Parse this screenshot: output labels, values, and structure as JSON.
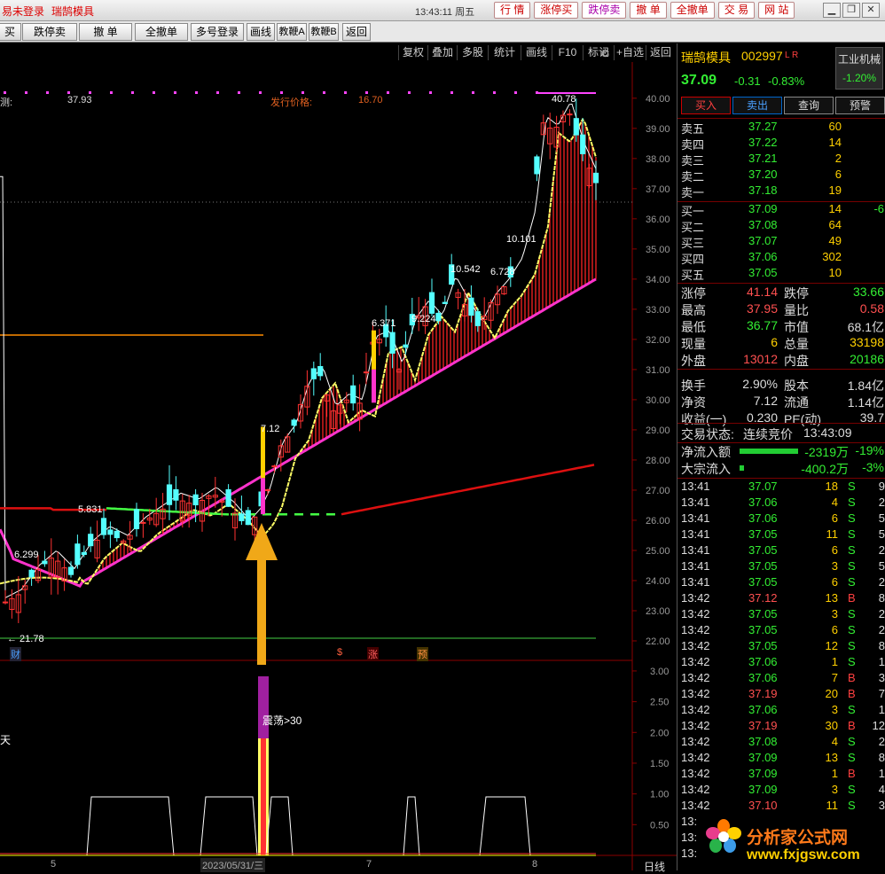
{
  "titlebar": {
    "status": "易未登录",
    "stock": "瑞鹄模具",
    "time": "13:43:11",
    "weekday": "周五",
    "buttons": [
      "行 情",
      "涨停买",
      "跌停卖",
      "撤 单",
      "全撤单",
      "交 易",
      "网 站"
    ],
    "window_icons": [
      "minimize-icon",
      "restore-icon",
      "close-icon"
    ]
  },
  "tradebar": {
    "buttons": [
      "买",
      "跌停卖",
      "撤 单",
      "全撤单",
      "多号登录",
      "画线",
      "教鞭A",
      "教鞭B",
      "返回"
    ]
  },
  "charttool": {
    "buttons": [
      "复权",
      "叠加",
      "多股",
      "统计",
      "画线",
      "F10",
      "标记",
      "+自选",
      "返回"
    ],
    "corner_icon": "gear-icon"
  },
  "chart_labels": {
    "predict_label": "测:",
    "predict_value": "37.93",
    "issue_label": "发行价格:",
    "issue_value": "16.70",
    "annotations": [
      "40.78",
      "10.101",
      "10.542",
      "6.728",
      "9.224",
      "6.371",
      "7.12",
      "5.831",
      "6.299",
      "← 21.78"
    ],
    "markers": [
      "财",
      "$",
      "涨",
      "预"
    ],
    "osc_label": "震荡>30",
    "left_label": "天",
    "date_label": "2023/05/31/三",
    "x_ticks": [
      "5",
      "7",
      "8"
    ],
    "day_line": "日线"
  },
  "chart_data": [
    {
      "type": "line",
      "title": "",
      "y_ticks": [
        "40.00",
        "39.00",
        "38.00",
        "37.00",
        "36.00",
        "35.00",
        "34.00",
        "33.00",
        "32.00",
        "31.00",
        "30.00",
        "29.00",
        "28.00",
        "27.00",
        "26.00",
        "25.00",
        "24.00",
        "23.00",
        "22.00"
      ],
      "ylim": [
        21.5,
        41.2
      ]
    },
    {
      "type": "line",
      "title": "",
      "y_ticks": [
        "3.00",
        "2.50",
        "2.00",
        "1.50",
        "1.00",
        "0.50"
      ],
      "ylim": [
        0,
        3.1
      ]
    }
  ],
  "colors": {
    "up": "#ff3232",
    "down": "#54ffff",
    "ma_white": "#ffffff",
    "ma_yellow": "#ffff66",
    "ma_magenta": "#ff33cc",
    "ma_red": "#dd1010",
    "ma_green": "#44ff44",
    "text_red": "#ff5050",
    "text_green": "#33ee33",
    "text_yellow": "#ffff00"
  },
  "quote": {
    "name": "瑞鹄模具",
    "code": "002997",
    "flags": "L R",
    "industry": "工业机械",
    "price": "37.09",
    "change": "-0.31",
    "pct": "-0.83%",
    "industry_pct": "-1.20%",
    "buttons": [
      "买入",
      "卖出",
      "查询",
      "预警"
    ],
    "asks": [
      {
        "label": "卖五",
        "price": "37.27",
        "vol": "60"
      },
      {
        "label": "卖四",
        "price": "37.22",
        "vol": "14"
      },
      {
        "label": "卖三",
        "price": "37.21",
        "vol": "2"
      },
      {
        "label": "卖二",
        "price": "37.20",
        "vol": "6"
      },
      {
        "label": "卖一",
        "price": "37.18",
        "vol": "19"
      }
    ],
    "bids": [
      {
        "label": "买一",
        "price": "37.09",
        "vol": "14",
        "extra": "-6"
      },
      {
        "label": "买二",
        "price": "37.08",
        "vol": "64",
        "extra": ""
      },
      {
        "label": "买三",
        "price": "37.07",
        "vol": "49",
        "extra": ""
      },
      {
        "label": "买四",
        "price": "37.06",
        "vol": "302",
        "extra": ""
      },
      {
        "label": "买五",
        "price": "37.05",
        "vol": "10",
        "extra": ""
      }
    ],
    "stats": [
      {
        "l1": "涨停",
        "v1": "41.14",
        "l2": "跌停",
        "v2": "33.66"
      },
      {
        "l1": "最高",
        "v1": "37.95",
        "l2": "量比",
        "v2": "0.58"
      },
      {
        "l1": "最低",
        "v1": "36.77",
        "l2": "市值",
        "v2": "68.1亿"
      },
      {
        "l1": "现量",
        "v1": "6",
        "l2": "总量",
        "v2": "33198"
      },
      {
        "l1": "外盘",
        "v1": "13012",
        "l2": "内盘",
        "v2": "20186"
      },
      {
        "l1": "换手",
        "v1": "2.90%",
        "l2": "股本",
        "v2": "1.84亿"
      },
      {
        "l1": "净资",
        "v1": "7.12",
        "l2": "流通",
        "v2": "1.14亿"
      },
      {
        "l1": "收益(一)",
        "v1": "0.230",
        "l2": "PE(动)",
        "v2": "39.7"
      }
    ],
    "trade_status_label": "交易状态:",
    "trade_status": "连续竞价",
    "trade_time": "13:43:09",
    "flows": [
      {
        "label": "净流入额",
        "value": "-2319万",
        "pct": "-19%"
      },
      {
        "label": "大宗流入",
        "value": "-400.2万",
        "pct": "-3%"
      }
    ],
    "ticks": [
      {
        "t": "13:41",
        "p": "37.07",
        "v": "18",
        "d": "S",
        "n": "9"
      },
      {
        "t": "13:41",
        "p": "37.06",
        "v": "4",
        "d": "S",
        "n": "2"
      },
      {
        "t": "13:41",
        "p": "37.06",
        "v": "6",
        "d": "S",
        "n": "5"
      },
      {
        "t": "13:41",
        "p": "37.05",
        "v": "11",
        "d": "S",
        "n": "5"
      },
      {
        "t": "13:41",
        "p": "37.05",
        "v": "6",
        "d": "S",
        "n": "2"
      },
      {
        "t": "13:41",
        "p": "37.05",
        "v": "3",
        "d": "S",
        "n": "5"
      },
      {
        "t": "13:41",
        "p": "37.05",
        "v": "6",
        "d": "S",
        "n": "2"
      },
      {
        "t": "13:42",
        "p": "37.12",
        "v": "13",
        "d": "B",
        "n": "8"
      },
      {
        "t": "13:42",
        "p": "37.05",
        "v": "3",
        "d": "S",
        "n": "2"
      },
      {
        "t": "13:42",
        "p": "37.05",
        "v": "6",
        "d": "S",
        "n": "2"
      },
      {
        "t": "13:42",
        "p": "37.05",
        "v": "12",
        "d": "S",
        "n": "8"
      },
      {
        "t": "13:42",
        "p": "37.06",
        "v": "1",
        "d": "S",
        "n": "1"
      },
      {
        "t": "13:42",
        "p": "37.06",
        "v": "7",
        "d": "B",
        "n": "3"
      },
      {
        "t": "13:42",
        "p": "37.19",
        "v": "20",
        "d": "B",
        "n": "7"
      },
      {
        "t": "13:42",
        "p": "37.06",
        "v": "3",
        "d": "S",
        "n": "1"
      },
      {
        "t": "13:42",
        "p": "37.19",
        "v": "30",
        "d": "B",
        "n": "12"
      },
      {
        "t": "13:42",
        "p": "37.08",
        "v": "4",
        "d": "S",
        "n": "2"
      },
      {
        "t": "13:42",
        "p": "37.09",
        "v": "13",
        "d": "S",
        "n": "8"
      },
      {
        "t": "13:42",
        "p": "37.09",
        "v": "1",
        "d": "B",
        "n": "1"
      },
      {
        "t": "13:42",
        "p": "37.09",
        "v": "3",
        "d": "S",
        "n": "4"
      },
      {
        "t": "13:42",
        "p": "37.10",
        "v": "11",
        "d": "S",
        "n": "3"
      },
      {
        "t": "13:",
        "p": "",
        "v": "",
        "d": "",
        "n": ""
      },
      {
        "t": "13:",
        "p": "",
        "v": "",
        "d": "",
        "n": ""
      },
      {
        "t": "13:",
        "p": "",
        "v": "",
        "d": "",
        "n": ""
      }
    ]
  },
  "watermark": {
    "line1": "分析家公式网",
    "line2": "www.fxjgsw.com"
  }
}
